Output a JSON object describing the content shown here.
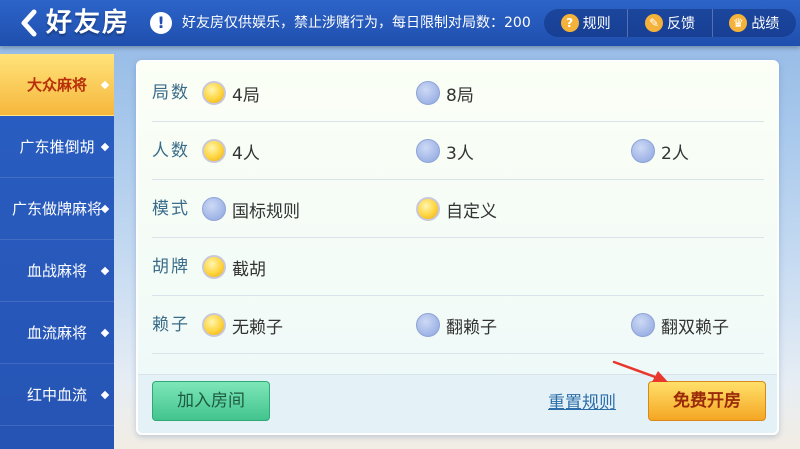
{
  "header": {
    "title": "好友房",
    "notice_icon": "!",
    "notice": "好友房仅供娱乐，禁止涉赌行为，每日限制对局数：200",
    "actions": [
      {
        "label": "规则",
        "icon": "question-icon",
        "glyph": "?"
      },
      {
        "label": "反馈",
        "icon": "edit-icon",
        "glyph": "✎"
      },
      {
        "label": "战绩",
        "icon": "trophy-icon",
        "glyph": "♛"
      }
    ]
  },
  "sidebar": {
    "items": [
      {
        "label": "大众麻将",
        "active": true
      },
      {
        "label": "广东推倒胡",
        "active": false
      },
      {
        "label": "广东做牌麻将",
        "active": false
      },
      {
        "label": "血战麻将",
        "active": false
      },
      {
        "label": "血流麻将",
        "active": false
      },
      {
        "label": "红中血流",
        "active": false
      }
    ]
  },
  "form": {
    "rows": [
      {
        "label": "局数",
        "options": [
          {
            "text": "4局",
            "selected": true
          },
          {
            "text": "8局",
            "selected": false
          }
        ]
      },
      {
        "label": "人数",
        "options": [
          {
            "text": "4人",
            "selected": true
          },
          {
            "text": "3人",
            "selected": false
          },
          {
            "text": "2人",
            "selected": false
          }
        ]
      },
      {
        "label": "模式",
        "options": [
          {
            "text": "国标规则",
            "selected": false
          },
          {
            "text": "自定义",
            "selected": true
          }
        ]
      },
      {
        "label": "胡牌",
        "options": [
          {
            "text": "截胡",
            "selected": true
          }
        ]
      },
      {
        "label": "赖子",
        "options": [
          {
            "text": "无赖子",
            "selected": true
          },
          {
            "text": "翻赖子",
            "selected": false
          },
          {
            "text": "翻双赖子",
            "selected": false
          }
        ]
      }
    ]
  },
  "buttons": {
    "join": "加入房间",
    "reset": "重置规则",
    "create": "免费开房"
  },
  "colors": {
    "header_blue": "#2c64c8",
    "active_tab": "#f6b73c",
    "join_green": "#42c48e",
    "create_orange": "#f5a623",
    "arrow_red": "#e8372c"
  }
}
